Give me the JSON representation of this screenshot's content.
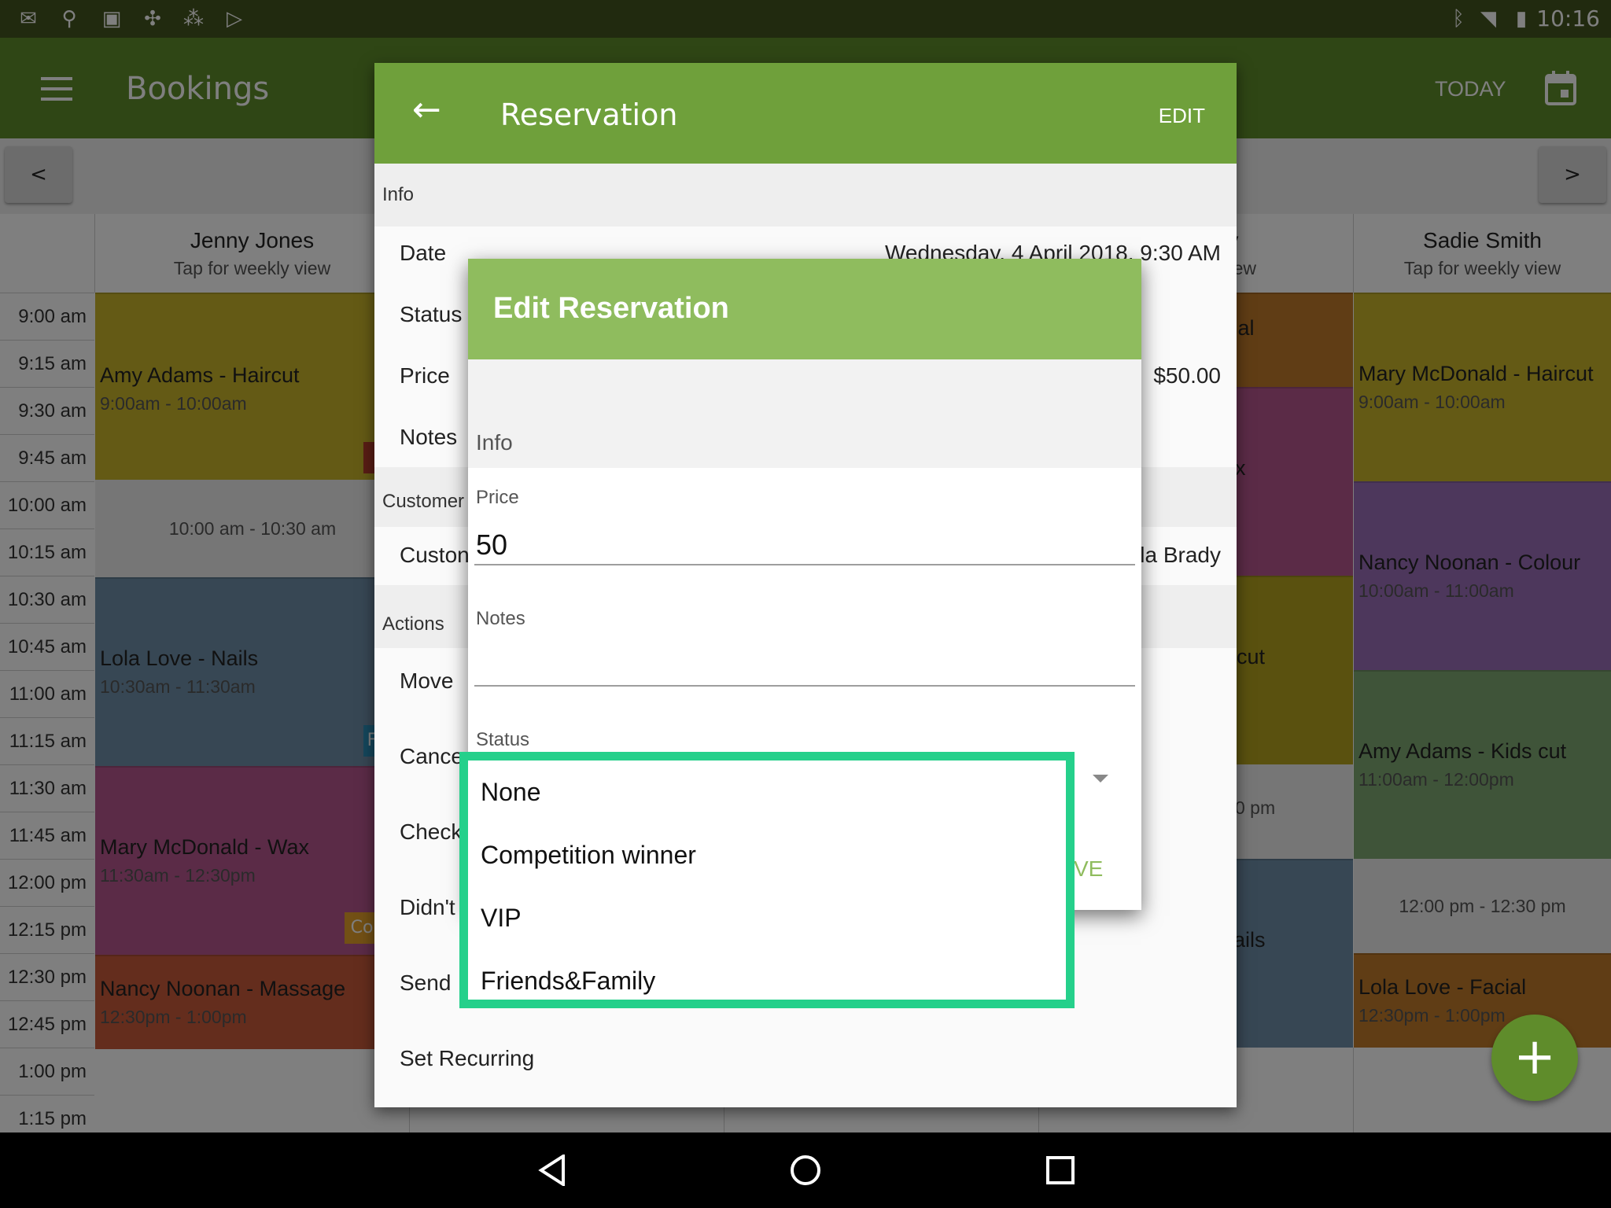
{
  "status_bar": {
    "time": "10:16"
  },
  "app_bar": {
    "title": "Bookings",
    "today_label": "TODAY"
  },
  "nav_prev": "<",
  "nav_next": ">",
  "staff": [
    {
      "name": "Jenny Jones",
      "sub": "Tap for weekly view"
    },
    {
      "name": "ry",
      "sub": "view"
    },
    {
      "name": "Sadie Smith",
      "sub": "Tap for weekly view"
    }
  ],
  "times": [
    "9:00 am",
    "9:15 am",
    "9:30 am",
    "9:45 am",
    "10:00 am",
    "10:15 am",
    "10:30 am",
    "10:45 am",
    "11:00 am",
    "11:15 am",
    "11:30 am",
    "11:45 am",
    "12:00 pm",
    "12:15 pm",
    "12:30 pm",
    "12:45 pm",
    "1:00 pm",
    "1:15 pm"
  ],
  "events_col1": [
    {
      "title": "Amy Adams - Haircut",
      "time": "9:00am - 10:00am",
      "color": "#c9b52b"
    },
    {
      "title": "Lola Love - Nails",
      "time": "10:30am - 11:30am",
      "color": "#6e8fa9"
    },
    {
      "title": "Mary McDonald - Wax",
      "time": "11:30am - 12:30pm",
      "color": "#b6578f"
    },
    {
      "title": "Nancy Noonan - Massage",
      "time": "12:30pm - 1:00pm",
      "color": "#c95a3b"
    }
  ],
  "gap_col1": "10:00 am - 10:30 am",
  "badge_col1": {
    "mid": "F",
    "low": "Co"
  },
  "events_col2": [
    {
      "title": "cial",
      "color": "#c07a2a"
    },
    {
      "title": "x",
      "color": "#b6578f"
    },
    {
      "title": "cut",
      "color": "#b4a21f"
    },
    {
      "title": "ails",
      "color": "#6e8fa9"
    }
  ],
  "gap_col2": "0 pm",
  "events_col3": [
    {
      "title": "Mary McDonald - Haircut",
      "time": "9:00am - 10:00am",
      "color": "#c9b52b"
    },
    {
      "title": "Nancy Noonan - Colour",
      "time": "10:00am - 11:00am",
      "color": "#9a6fb8"
    },
    {
      "title": "Amy Adams - Kids cut",
      "time": "11:00am - 12:00pm",
      "color": "#7fa873"
    },
    {
      "title": "Lola Love - Facial",
      "time": "12:30pm - 1:00pm",
      "color": "#c07a2a"
    }
  ],
  "gap_col3": "12:00 pm - 12:30 pm",
  "reservation": {
    "title": "Reservation",
    "edit_label": "EDIT",
    "section_info": "Info",
    "rows": [
      {
        "label": "Date",
        "value": "Wednesday, 4 April 2018, 9:30 AM"
      },
      {
        "label": "Status",
        "value": ""
      },
      {
        "label": "Price",
        "value": "$50.00"
      },
      {
        "label": "Notes",
        "value": ""
      }
    ],
    "section_customer": "Customer",
    "customer_label": "Custon",
    "customer_value": "la Brady",
    "section_actions": "Actions",
    "actions": [
      "Move",
      "Cance",
      "Check",
      "Didn't",
      "Send",
      "Set Recurring"
    ]
  },
  "edit_dialog": {
    "title": "Edit Reservation",
    "section_info": "Info",
    "price_label": "Price",
    "price_value": "50",
    "notes_label": "Notes",
    "notes_value": "",
    "status_label": "Status",
    "save_label": "VE"
  },
  "status_options": [
    "None",
    "Competition winner",
    "VIP",
    "Friends&Family"
  ],
  "colors": {
    "primary": "#5f8c2b",
    "dialog_header": "#8fbc5e",
    "highlight": "#25d08b"
  }
}
